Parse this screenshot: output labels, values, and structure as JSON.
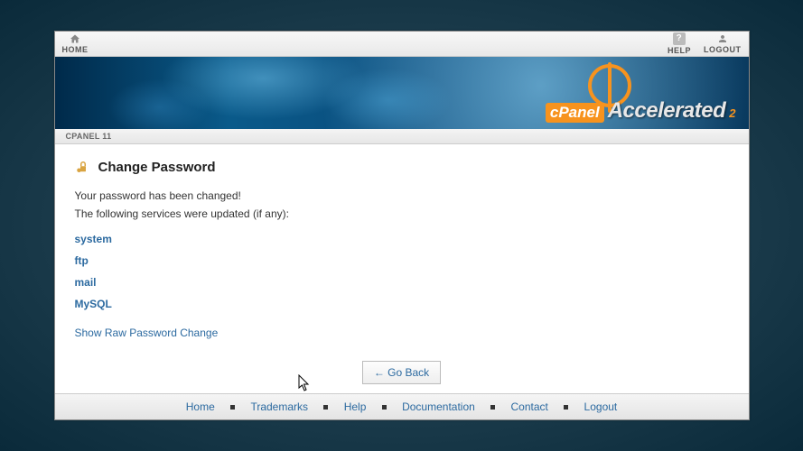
{
  "topnav": {
    "home": "HOME",
    "help": "HELP",
    "logout": "LOGOUT"
  },
  "brand": {
    "name": "cPanel",
    "tagline": "Accelerated",
    "sub": "2"
  },
  "breadcrumb": "CPANEL 11",
  "page": {
    "title": "Change Password",
    "message_line1": "Your password has been changed!",
    "message_line2": "The following services were updated (if any):",
    "services": [
      "system",
      "ftp",
      "mail",
      "MySQL"
    ],
    "raw_link": "Show Raw Password Change",
    "goback": "← Go Back"
  },
  "footer": {
    "links": [
      "Home",
      "Trademarks",
      "Help",
      "Documentation",
      "Contact",
      "Logout"
    ]
  }
}
